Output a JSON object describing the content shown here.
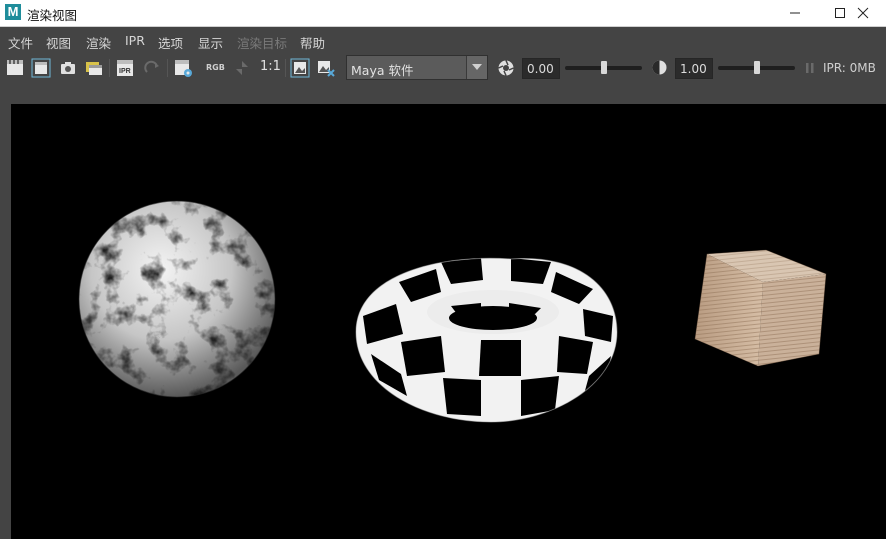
{
  "window": {
    "title": "渲染视图",
    "app_icon_letter": "M",
    "controls": [
      "minimize",
      "maximize",
      "close"
    ]
  },
  "menu": [
    {
      "label": "文件",
      "enabled": true
    },
    {
      "label": "视图",
      "enabled": true
    },
    {
      "label": "渲染",
      "enabled": true
    },
    {
      "label": "IPR",
      "enabled": true
    },
    {
      "label": "选项",
      "enabled": true
    },
    {
      "label": "显示",
      "enabled": true
    },
    {
      "label": "渲染目标",
      "enabled": false
    },
    {
      "label": "帮助",
      "enabled": true
    }
  ],
  "toolbar": {
    "icons": [
      "render-icon",
      "render-region-icon",
      "snapshot-icon",
      "render-sequence-icon",
      "ipr-render-icon",
      "refresh-ipr-icon",
      "render-settings-icon",
      "rgb-channels-icon",
      "alpha-icon"
    ],
    "rgb_label": "RGB",
    "ratio_label": "1:1",
    "renderer": "Maya 软件",
    "exposure_value": "0.00",
    "gamma_value": "1.00",
    "exposure_level": 0.5,
    "gamma_level": 0.5,
    "ipr_memory": "IPR: 0MB"
  },
  "render": {
    "objects": [
      "marble-sphere",
      "checker-torus",
      "wood-cube"
    ],
    "background": "#000000"
  }
}
